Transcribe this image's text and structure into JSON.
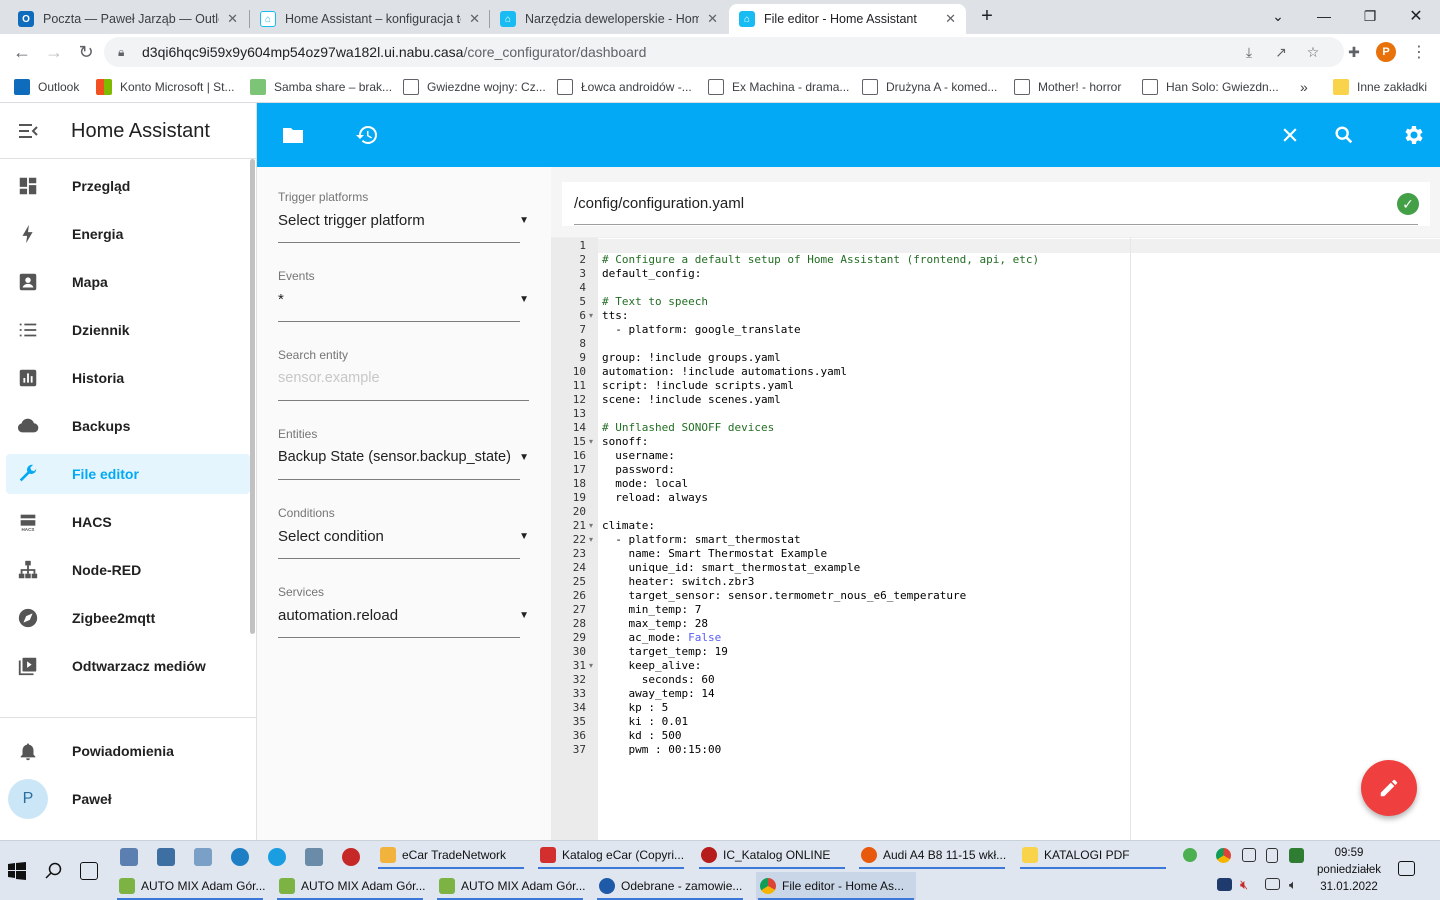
{
  "browser": {
    "tabs": [
      {
        "title": "Poczta — Paweł Jarząb — Outlook",
        "icon": "outlook-icon",
        "active": false
      },
      {
        "title": "Home Assistant – konfiguracja termostatu",
        "icon": "ha-icon",
        "active": false
      },
      {
        "title": "Narzędzia deweloperskie - Home Assistant",
        "icon": "ha-icon",
        "active": false
      },
      {
        "title": "File editor - Home Assistant",
        "icon": "ha-icon",
        "active": true
      }
    ],
    "new_tab": "+",
    "address": {
      "host": "d3qi6hqc9i59x9y604mp54oz97wa182l.ui.nabu.casa",
      "path": "/core_configurator/dashboard"
    },
    "profile_letter": "P",
    "bookmarks": [
      "Outlook",
      "Konto Microsoft | St...",
      "Samba share – brak...",
      "Gwiezdne wojny: Cz...",
      "Łowca androidów -...",
      "Ex Machina - drama...",
      "Drużyna A - komed...",
      "Mother! - horror",
      "Han Solo: Gwiezdn..."
    ],
    "bookmarks_more": "»",
    "other_bookmarks": "Inne zakładki"
  },
  "sidebar": {
    "title": "Home Assistant",
    "items": [
      {
        "label": "Przegląd",
        "icon": "dashboard-icon"
      },
      {
        "label": "Energia",
        "icon": "lightning-icon"
      },
      {
        "label": "Mapa",
        "icon": "map-person-icon"
      },
      {
        "label": "Dziennik",
        "icon": "list-icon"
      },
      {
        "label": "Historia",
        "icon": "chart-bar-icon"
      },
      {
        "label": "Backups",
        "icon": "cloud-icon"
      },
      {
        "label": "File editor",
        "icon": "wrench-icon",
        "selected": true
      },
      {
        "label": "HACS",
        "icon": "hacs-icon"
      },
      {
        "label": "Node-RED",
        "icon": "sitemap-icon"
      },
      {
        "label": "Zigbee2mqtt",
        "icon": "compass-icon"
      },
      {
        "label": "Odtwarzacz mediów",
        "icon": "media-icon"
      }
    ],
    "notifications": "Powiadomienia",
    "user": {
      "initial": "P",
      "name": "Paweł"
    }
  },
  "panel": {
    "fields": [
      {
        "label": "Trigger platforms",
        "value": "Select trigger platform",
        "placeholder": false
      },
      {
        "label": "Events",
        "value": "*",
        "placeholder": false
      },
      {
        "label": "Search entity",
        "value": "sensor.example",
        "placeholder": true
      },
      {
        "label": "Entities",
        "value": "Backup State (sensor.backup_state)",
        "placeholder": false
      },
      {
        "label": "Conditions",
        "value": "Select condition",
        "placeholder": false
      },
      {
        "label": "Services",
        "value": "automation.reload",
        "placeholder": false
      }
    ]
  },
  "editor": {
    "file_path": "/config/configuration.yaml",
    "lines": [
      {
        "n": "1",
        "t": "",
        "k": "plain"
      },
      {
        "n": "2",
        "t": "# Configure a default setup of Home Assistant (frontend, api, etc)",
        "k": "comment"
      },
      {
        "n": "3",
        "t": "default_config:",
        "k": "plain"
      },
      {
        "n": "4",
        "t": "",
        "k": "plain"
      },
      {
        "n": "5",
        "t": "# Text to speech",
        "k": "comment"
      },
      {
        "n": "6",
        "t": "tts:",
        "k": "plain",
        "fold": true
      },
      {
        "n": "7",
        "t": "  - platform: google_translate",
        "k": "plain"
      },
      {
        "n": "8",
        "t": "",
        "k": "plain"
      },
      {
        "n": "9",
        "t": "group: !include groups.yaml",
        "k": "plain"
      },
      {
        "n": "10",
        "t": "automation: !include automations.yaml",
        "k": "plain"
      },
      {
        "n": "11",
        "t": "script: !include scripts.yaml",
        "k": "plain"
      },
      {
        "n": "12",
        "t": "scene: !include scenes.yaml",
        "k": "plain"
      },
      {
        "n": "13",
        "t": "",
        "k": "plain"
      },
      {
        "n": "14",
        "t": "# Unflashed SONOFF devices",
        "k": "comment"
      },
      {
        "n": "15",
        "t": "sonoff:",
        "k": "plain",
        "fold": true
      },
      {
        "n": "16",
        "t": "  username:",
        "k": "plain"
      },
      {
        "n": "17",
        "t": "  password:",
        "k": "plain"
      },
      {
        "n": "18",
        "t": "  mode: local",
        "k": "plain"
      },
      {
        "n": "19",
        "t": "  reload: always",
        "k": "plain"
      },
      {
        "n": "20",
        "t": "",
        "k": "plain"
      },
      {
        "n": "21",
        "t": "climate:",
        "k": "plain",
        "fold": true
      },
      {
        "n": "22",
        "t": "  - platform: smart_thermostat",
        "k": "plain",
        "fold": true
      },
      {
        "n": "23",
        "t": "    name: Smart Thermostat Example",
        "k": "plain"
      },
      {
        "n": "24",
        "t": "    unique_id: smart_thermostat_example",
        "k": "plain"
      },
      {
        "n": "25",
        "t": "    heater: switch.zbr3",
        "k": "plain"
      },
      {
        "n": "26",
        "t": "    target_sensor: sensor.termometr_nous_e6_temperature",
        "k": "plain"
      },
      {
        "n": "27",
        "t": "    min_temp: 7",
        "k": "plain"
      },
      {
        "n": "28",
        "t": "    max_temp: 28",
        "k": "plain"
      },
      {
        "n": "29",
        "t": "    ac_mode: False",
        "k": "bool"
      },
      {
        "n": "30",
        "t": "    target_temp: 19",
        "k": "plain"
      },
      {
        "n": "31",
        "t": "    keep_alive:",
        "k": "plain",
        "fold": true
      },
      {
        "n": "32",
        "t": "      seconds: 60",
        "k": "plain"
      },
      {
        "n": "33",
        "t": "    away_temp: 14",
        "k": "plain"
      },
      {
        "n": "34",
        "t": "    kp : 5",
        "k": "plain"
      },
      {
        "n": "35",
        "t": "    ki : 0.01",
        "k": "plain"
      },
      {
        "n": "36",
        "t": "    kd : 500",
        "k": "plain"
      },
      {
        "n": "37",
        "t": "    pwm : 00:15:00",
        "k": "plain"
      }
    ]
  },
  "taskbar": {
    "pinned_row1": [
      {
        "label": "eCar TradeNetwork",
        "icon": "ecar-icon"
      },
      {
        "label": "Katalog eCar (Copyri...",
        "icon": "katalog-icon"
      },
      {
        "label": "IC_Katalog ONLINE",
        "icon": "ic-katalog-icon"
      },
      {
        "label": "Audi A4 B8 11-15 wkł...",
        "icon": "firefox-icon"
      },
      {
        "label": "KATALOGI PDF",
        "icon": "folder-icon"
      }
    ],
    "pinned_row2": [
      {
        "label": "AUTO MIX Adam Gór...",
        "icon": "automix-icon"
      },
      {
        "label": "AUTO MIX Adam Gór...",
        "icon": "automix-icon"
      },
      {
        "label": "AUTO MIX Adam Gór...",
        "icon": "automix-icon"
      },
      {
        "label": "Odebrane - zamowie...",
        "icon": "thunderbird-icon"
      },
      {
        "label": "File editor - Home As...",
        "icon": "chrome-icon"
      }
    ],
    "time": "09:59",
    "day": "poniedziałek",
    "date": "31.01.2022"
  },
  "colors": {
    "ha_primary": "#03a9f4",
    "fab": "#ef3f3f",
    "valid": "#43a047"
  }
}
